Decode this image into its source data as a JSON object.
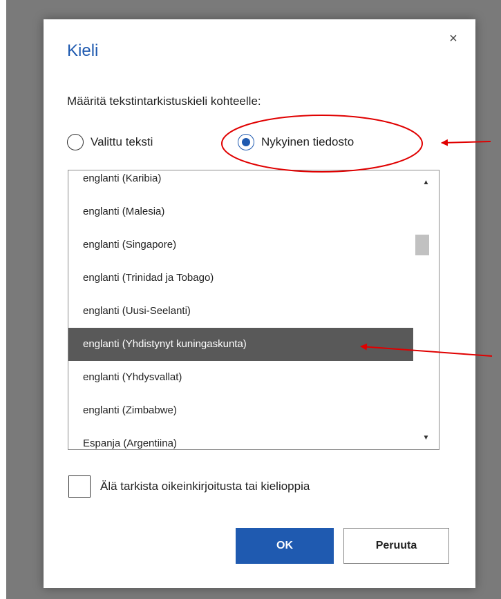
{
  "dialog": {
    "title": "Kieli",
    "close_glyph": "×",
    "subtitle": "Määritä tekstintarkistuskieli kohteelle:",
    "radio_options": [
      {
        "label": "Valittu teksti",
        "checked": false
      },
      {
        "label": "Nykyinen tiedosto",
        "checked": true
      }
    ],
    "languages": [
      "englanti (Karibia)",
      "englanti (Malesia)",
      "englanti (Singapore)",
      "englanti (Trinidad ja Tobago)",
      "englanti (Uusi-Seelanti)",
      "englanti (Yhdistynyt kuningaskunta)",
      "englanti (Yhdysvallat)",
      "englanti (Zimbabwe)",
      "Espanja (Argentiina)"
    ],
    "selected_language": "englanti (Yhdistynyt kuningaskunta)",
    "checkbox": {
      "label": "Älä tarkista oikeinkirjoitusta tai kielioppia",
      "checked": false
    },
    "buttons": {
      "ok": "OK",
      "cancel": "Peruuta"
    },
    "icons": {
      "close": "close-icon",
      "scroll_up": "scroll-up-arrow-icon",
      "scroll_down": "scroll-down-arrow-icon"
    }
  },
  "colors": {
    "accent": "#1f5ab0",
    "selection": "#595959",
    "annotation": "#e00000",
    "backdrop": "#7a7a7a"
  }
}
